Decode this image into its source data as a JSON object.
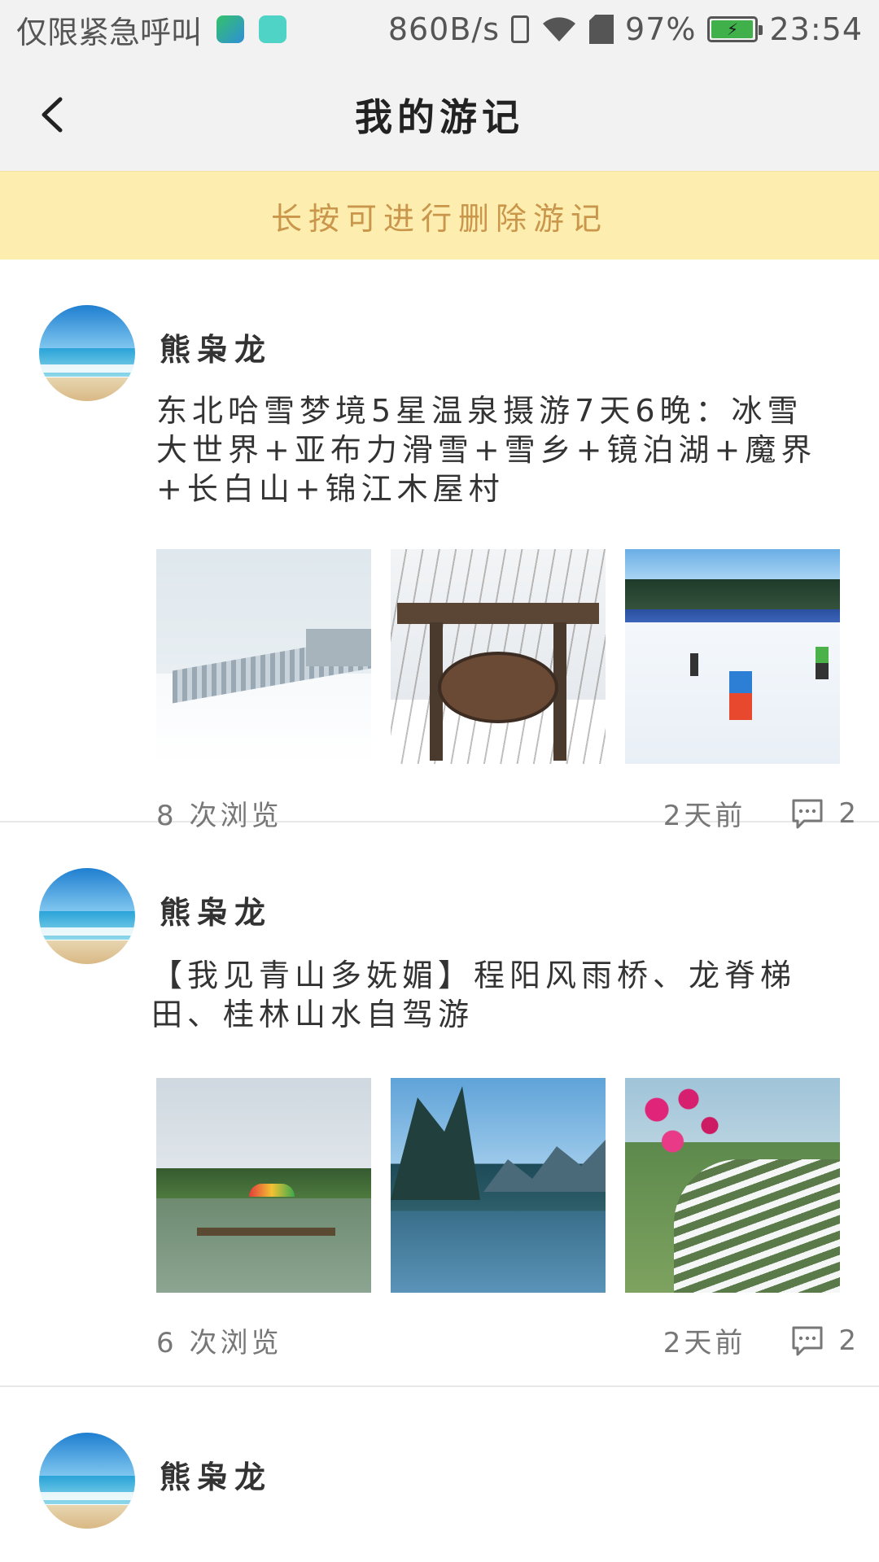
{
  "status_bar": {
    "carrier_text": "仅限紧急呼叫",
    "network_speed": "860B/s",
    "battery": "97%",
    "battery_level": 0.97,
    "time": "23:54"
  },
  "header": {
    "title": "我的游记"
  },
  "tip": {
    "text": "长按可进行删除游记"
  },
  "posts": [
    {
      "author": "熊枭龙",
      "title": "东北哈雪梦境5星温泉摄游7天6晚：冰雪大世界+亚布力滑雪+雪乡+镜泊湖+魔界+长白山+锦江木屋村",
      "views": "8 次浏览",
      "date": "2天前",
      "comments": "2"
    },
    {
      "author": "熊枭龙",
      "title": "【我见青山多妩媚】程阳风雨桥、龙脊梯田、桂林山水自驾游",
      "views": "6 次浏览",
      "date": "2天前",
      "comments": "2"
    },
    {
      "author": "熊枭龙"
    }
  ],
  "colors": {
    "tip_background": "#fdeeb0",
    "tip_text": "#c9964b",
    "header_background": "#f2f2f2"
  }
}
